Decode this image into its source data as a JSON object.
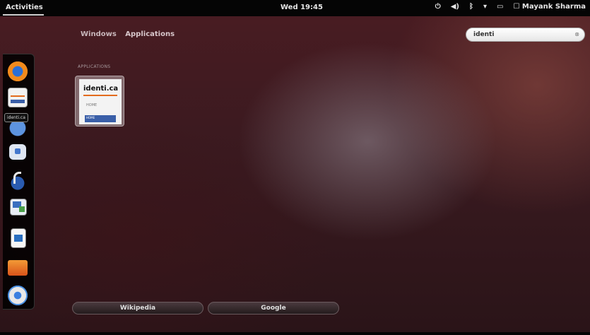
{
  "topbar": {
    "activities": "Activities",
    "clock": "Wed 19:45",
    "user": "Mayank Sharma",
    "tray_icons": [
      "accessibility-icon",
      "volume-icon",
      "bluetooth-icon",
      "network-icon",
      "battery-icon",
      "chat-status-icon"
    ]
  },
  "dash": {
    "items": [
      "firefox-icon",
      "identica-icon",
      "empathy-icon",
      "chat-icon",
      "banshee-icon",
      "writer-icon",
      "document-icon",
      "files-icon",
      "chromium-icon"
    ],
    "tooltip": "identi.ca"
  },
  "view_tabs": {
    "windows": "Windows",
    "applications": "Applications"
  },
  "search": {
    "value": "identi",
    "clear_icon": "clear-icon"
  },
  "results": {
    "section": "APPLICATIONS",
    "app": {
      "logo": "identi.ca",
      "home": "HOME",
      "band": "HOME"
    }
  },
  "providers": {
    "wikipedia": "Wikipedia",
    "google": "Google"
  }
}
